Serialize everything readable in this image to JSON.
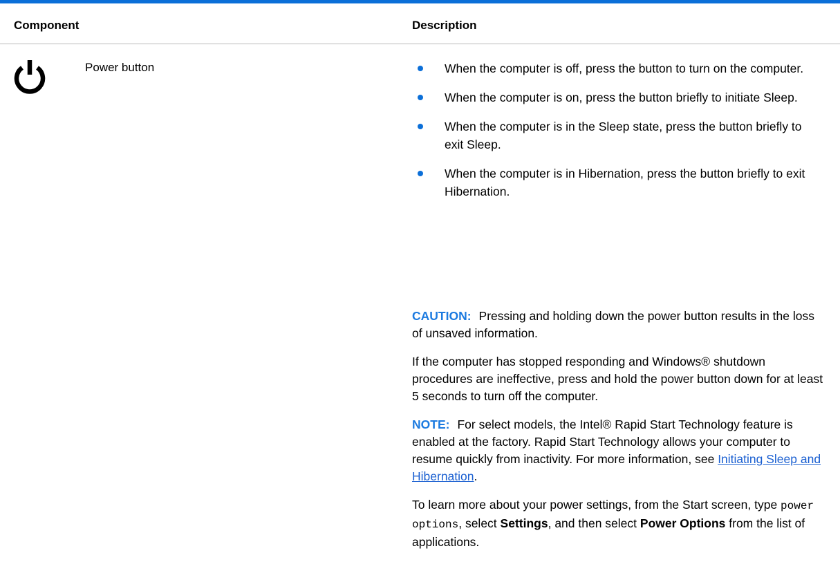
{
  "header": {
    "component": "Component",
    "description": "Description"
  },
  "row": {
    "icon": "power-icon",
    "name": "Power button",
    "bullets": [
      "When the computer is off, press the button to turn on the computer.",
      "When the computer is on, press the button briefly to initiate Sleep.",
      "When the computer is in the Sleep state, press the button briefly to exit Sleep.",
      "When the computer is in Hibernation, press the button briefly to exit Hibernation."
    ],
    "caution": {
      "label": "CAUTION:",
      "text": "Pressing and holding down the power button results in the loss of unsaved information."
    },
    "stopped": "If the computer has stopped responding and Windows® shutdown procedures are ineffective, press and hold the power button down for at least 5 seconds to turn off the computer.",
    "note": {
      "label": "NOTE:",
      "text": "For select models, the Intel® Rapid Start Technology feature is enabled at the factory. Rapid Start Technology allows your computer to resume quickly from inactivity. For more information, see",
      "link": "Initiating Sleep and Hibernation",
      "end": "."
    },
    "learn": {
      "part1": "To learn more about your power settings, from the Start screen, type",
      "code": "power options",
      "part2": ", select",
      "bold1": "Settings",
      "part3": ", and then select",
      "bold2": "Power Options",
      "part4": "from the list of applications."
    }
  },
  "colors": {
    "accent": "#0b6fd8",
    "label": "#1b7ae0",
    "link": "#1a5fd1"
  }
}
